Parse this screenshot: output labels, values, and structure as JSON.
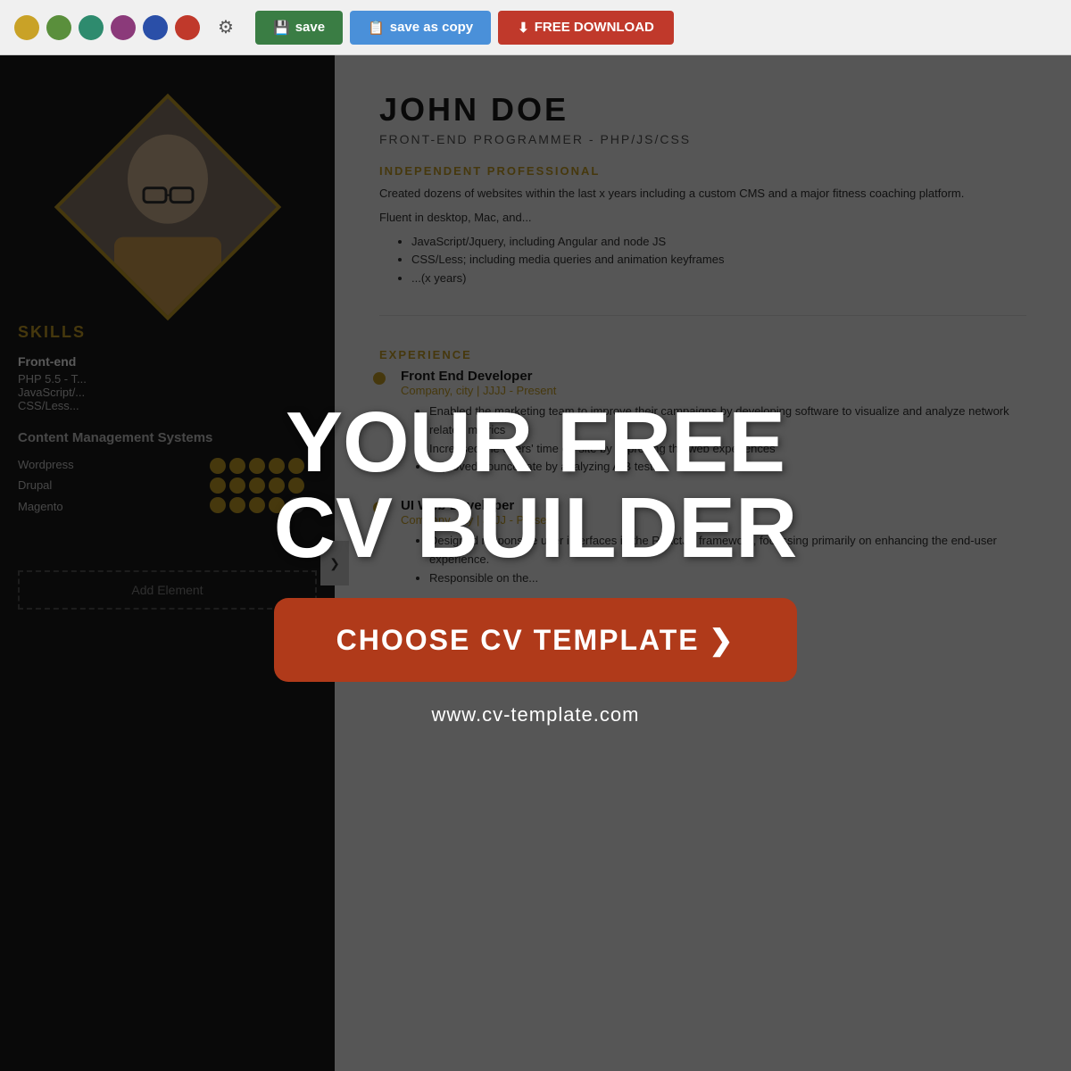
{
  "toolbar": {
    "colors": [
      {
        "name": "yellow",
        "hex": "#c9a227"
      },
      {
        "name": "green",
        "hex": "#5a8f3c"
      },
      {
        "name": "teal",
        "hex": "#2e8b6e"
      },
      {
        "name": "purple",
        "hex": "#8b3a7a"
      },
      {
        "name": "blue",
        "hex": "#2a4fa8"
      },
      {
        "name": "red",
        "hex": "#c0392b"
      }
    ],
    "save_label": "save",
    "save_copy_label": "save as copy",
    "download_label": "FREE DOWNLOAD",
    "save_icon": "💾",
    "copy_icon": "📋",
    "download_icon": "⬇"
  },
  "left_panel": {
    "skills_title": "SKILLS",
    "skill1_label": "Front-end",
    "skill1_value": "PHP 5.5 - T...\nJavaScript/...\nCSS/Less...",
    "cms_title": "Content Management Systems",
    "cms_items": [
      "Wordpress",
      "Drupal",
      "Magento"
    ],
    "add_element_label": "Add Element"
  },
  "cv": {
    "name": "JOHN  DOE",
    "job_title": "FRONT-END PROGRAMMER - PHP/JS/CSS",
    "section_professional": "INDEPENDENT PROFESSIONAL",
    "professional_text1": "Created dozens of websites within the last x years including a custom CMS and a major fitness coaching platform.",
    "professional_text2": "Fluent in desktop, Mac, and...",
    "bullets": [
      "JavaScript/Jquery, including Angular and node JS",
      "CSS/Less; including media queries and animation keyframes",
      "...(x years)"
    ],
    "experience_title": "EXPERIENCE",
    "jobs": [
      {
        "title": "Front End Developer",
        "company": "Company, city | JJJJ - Present",
        "bullets": [
          "Enabled the marketing team to improve their campaigns by developing software to visualize and analyze network related metrics",
          "Increased the users' time on-site by improving the web experiences",
          "Improved bounce rate by analyzing A/B tests"
        ]
      },
      {
        "title": "UI Web Developer",
        "company": "Company, city | JJJJ - Present",
        "bullets": [
          "Designed responsive user interfaces in the ReactJS framework, focussing primarily on enhancing the end-user experience.",
          "Responsible on the..."
        ]
      }
    ]
  },
  "overlay": {
    "headline_line1": "YOUR FREE",
    "headline_line2": "CV BUILDER",
    "cta_label": "CHOOSE CV TEMPLATE ❯",
    "website": "www.cv-template.com"
  }
}
